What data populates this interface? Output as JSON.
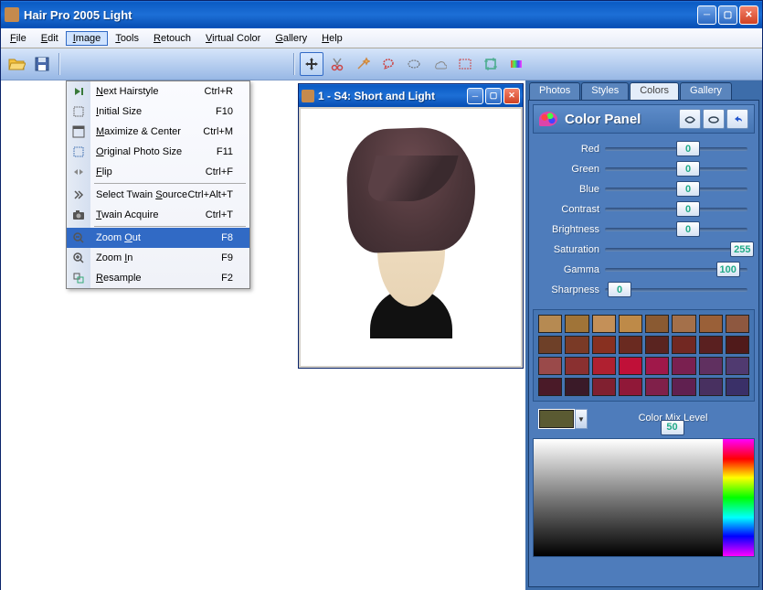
{
  "window": {
    "title": "Hair Pro 2005  Light"
  },
  "menu": {
    "items": [
      "File",
      "Edit",
      "Image",
      "Tools",
      "Retouch",
      "Virtual Color",
      "Gallery",
      "Help"
    ],
    "open_index": 2
  },
  "dropdown": {
    "items": [
      {
        "label": "Next Hairstyle",
        "u": 0,
        "shortcut": "Ctrl+R",
        "icon": "next"
      },
      {
        "label": "Initial Size",
        "u": 0,
        "shortcut": "F10",
        "icon": "size"
      },
      {
        "label": "Maximize & Center",
        "u": 0,
        "shortcut": "Ctrl+M",
        "icon": "max"
      },
      {
        "label": "Original Photo Size",
        "u": 0,
        "shortcut": "F11",
        "icon": "orig"
      },
      {
        "label": "Flip",
        "u": 0,
        "shortcut": "Ctrl+F",
        "icon": "flip"
      },
      {
        "sep": true
      },
      {
        "label": "Select Twain Source",
        "u": 13,
        "shortcut": "Ctrl+Alt+T",
        "icon": "twain"
      },
      {
        "label": "Twain Acquire",
        "u": 0,
        "shortcut": "Ctrl+T",
        "icon": "camera"
      },
      {
        "sep": true
      },
      {
        "label": "Zoom Out",
        "u": 5,
        "shortcut": "F8",
        "icon": "zoomout",
        "hover": true
      },
      {
        "label": "Zoom In",
        "u": 5,
        "shortcut": "F9",
        "icon": "zoomin"
      },
      {
        "label": "Resample",
        "u": 0,
        "shortcut": "F2",
        "icon": "resample"
      }
    ]
  },
  "toolbar": {
    "groups": [
      [
        "open",
        "save"
      ],
      [
        "tool-a",
        "tool-b",
        "tool-c",
        "tool-d",
        "tool-e",
        "tool-f",
        "tool-g",
        "tool-h",
        "tool-i"
      ],
      [
        "move",
        "cut",
        "wand",
        "lasso",
        "ellipse",
        "cloud",
        "marquee",
        "crop",
        "prism"
      ]
    ],
    "selected": "move"
  },
  "subwindow": {
    "title": "1 - S4: Short and Light"
  },
  "side": {
    "tabs": [
      "Photos",
      "Styles",
      "Colors",
      "Gallery"
    ],
    "active_tab": 2,
    "panel_title": "Color Panel",
    "sliders": [
      {
        "label": "Red",
        "value": 0,
        "pos": 50
      },
      {
        "label": "Green",
        "value": 0,
        "pos": 50
      },
      {
        "label": "Blue",
        "value": 0,
        "pos": 50
      },
      {
        "label": "Contrast",
        "value": 0,
        "pos": 50
      },
      {
        "label": "Brightness",
        "value": 0,
        "pos": 50
      },
      {
        "label": "Saturation",
        "value": 255,
        "pos": 88
      },
      {
        "label": "Gamma",
        "value": 100,
        "pos": 78
      },
      {
        "label": "Sharpness",
        "value": 0,
        "pos": 2
      }
    ],
    "swatches": [
      "#b68a52",
      "#a07438",
      "#c49058",
      "#be8a48",
      "#8a5a32",
      "#a4704a",
      "#9a6038",
      "#8e5840",
      "#6e4028",
      "#7a3a26",
      "#883020",
      "#6a2a20",
      "#5a2420",
      "#722822",
      "#5a2020",
      "#501a1a",
      "#9a4a4a",
      "#8a3030",
      "#b02030",
      "#c01038",
      "#a0184a",
      "#7a2050",
      "#603060",
      "#503a70",
      "#4a1a28",
      "#3a1a28",
      "#802030",
      "#901838",
      "#80204a",
      "#602050",
      "#483060",
      "#3a3068"
    ],
    "mix_label": "Color Mix Level",
    "mix_value": 50,
    "mix_color": "#5a5a32"
  }
}
